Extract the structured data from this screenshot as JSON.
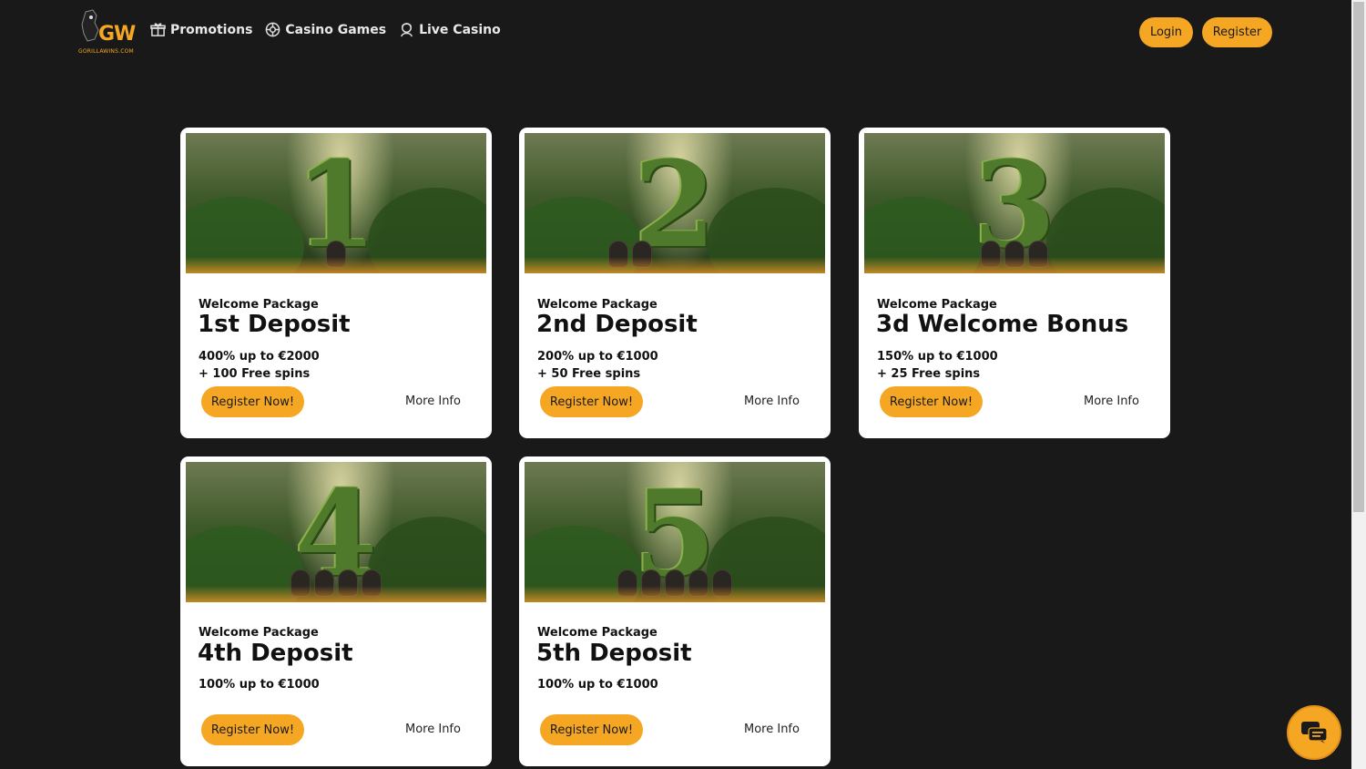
{
  "header": {
    "logo_letters": "GW",
    "logo_sub": "GORILLAWINS.COM",
    "nav": [
      {
        "label": "Promotions",
        "icon": "gift-icon"
      },
      {
        "label": "Casino Games",
        "icon": "chip-icon"
      },
      {
        "label": "Live Casino",
        "icon": "dealer-icon"
      }
    ],
    "login": "Login",
    "register": "Register"
  },
  "cards": [
    {
      "package": "Welcome Package",
      "title": "1st Deposit",
      "line1": "400% up to €2000",
      "line2": "+ 100 Free spins",
      "cta": "Register Now!",
      "more": "More Info",
      "numeral": "1"
    },
    {
      "package": "Welcome Package",
      "title": "2nd Deposit",
      "line1": "200% up to €1000",
      "line2": "+ 50 Free spins",
      "cta": "Register Now!",
      "more": "More Info",
      "numeral": "2"
    },
    {
      "package": "Welcome Package",
      "title": "3d Welcome Bonus",
      "line1": "150% up to €1000",
      "line2": "+ 25 Free spins",
      "cta": "Register Now!",
      "more": "More Info",
      "numeral": "3"
    },
    {
      "package": "Welcome Package",
      "title": "4th Deposit",
      "line1": "100% up to €1000",
      "line2": "",
      "cta": "Register Now!",
      "more": "More Info",
      "numeral": "4"
    },
    {
      "package": "Welcome Package",
      "title": "5th Deposit",
      "line1": "100% up to €1000",
      "line2": "",
      "cta": "Register Now!",
      "more": "More Info",
      "numeral": "5"
    }
  ],
  "colors": {
    "accent": "#f5a623",
    "background": "#191919",
    "card": "#ffffff"
  }
}
